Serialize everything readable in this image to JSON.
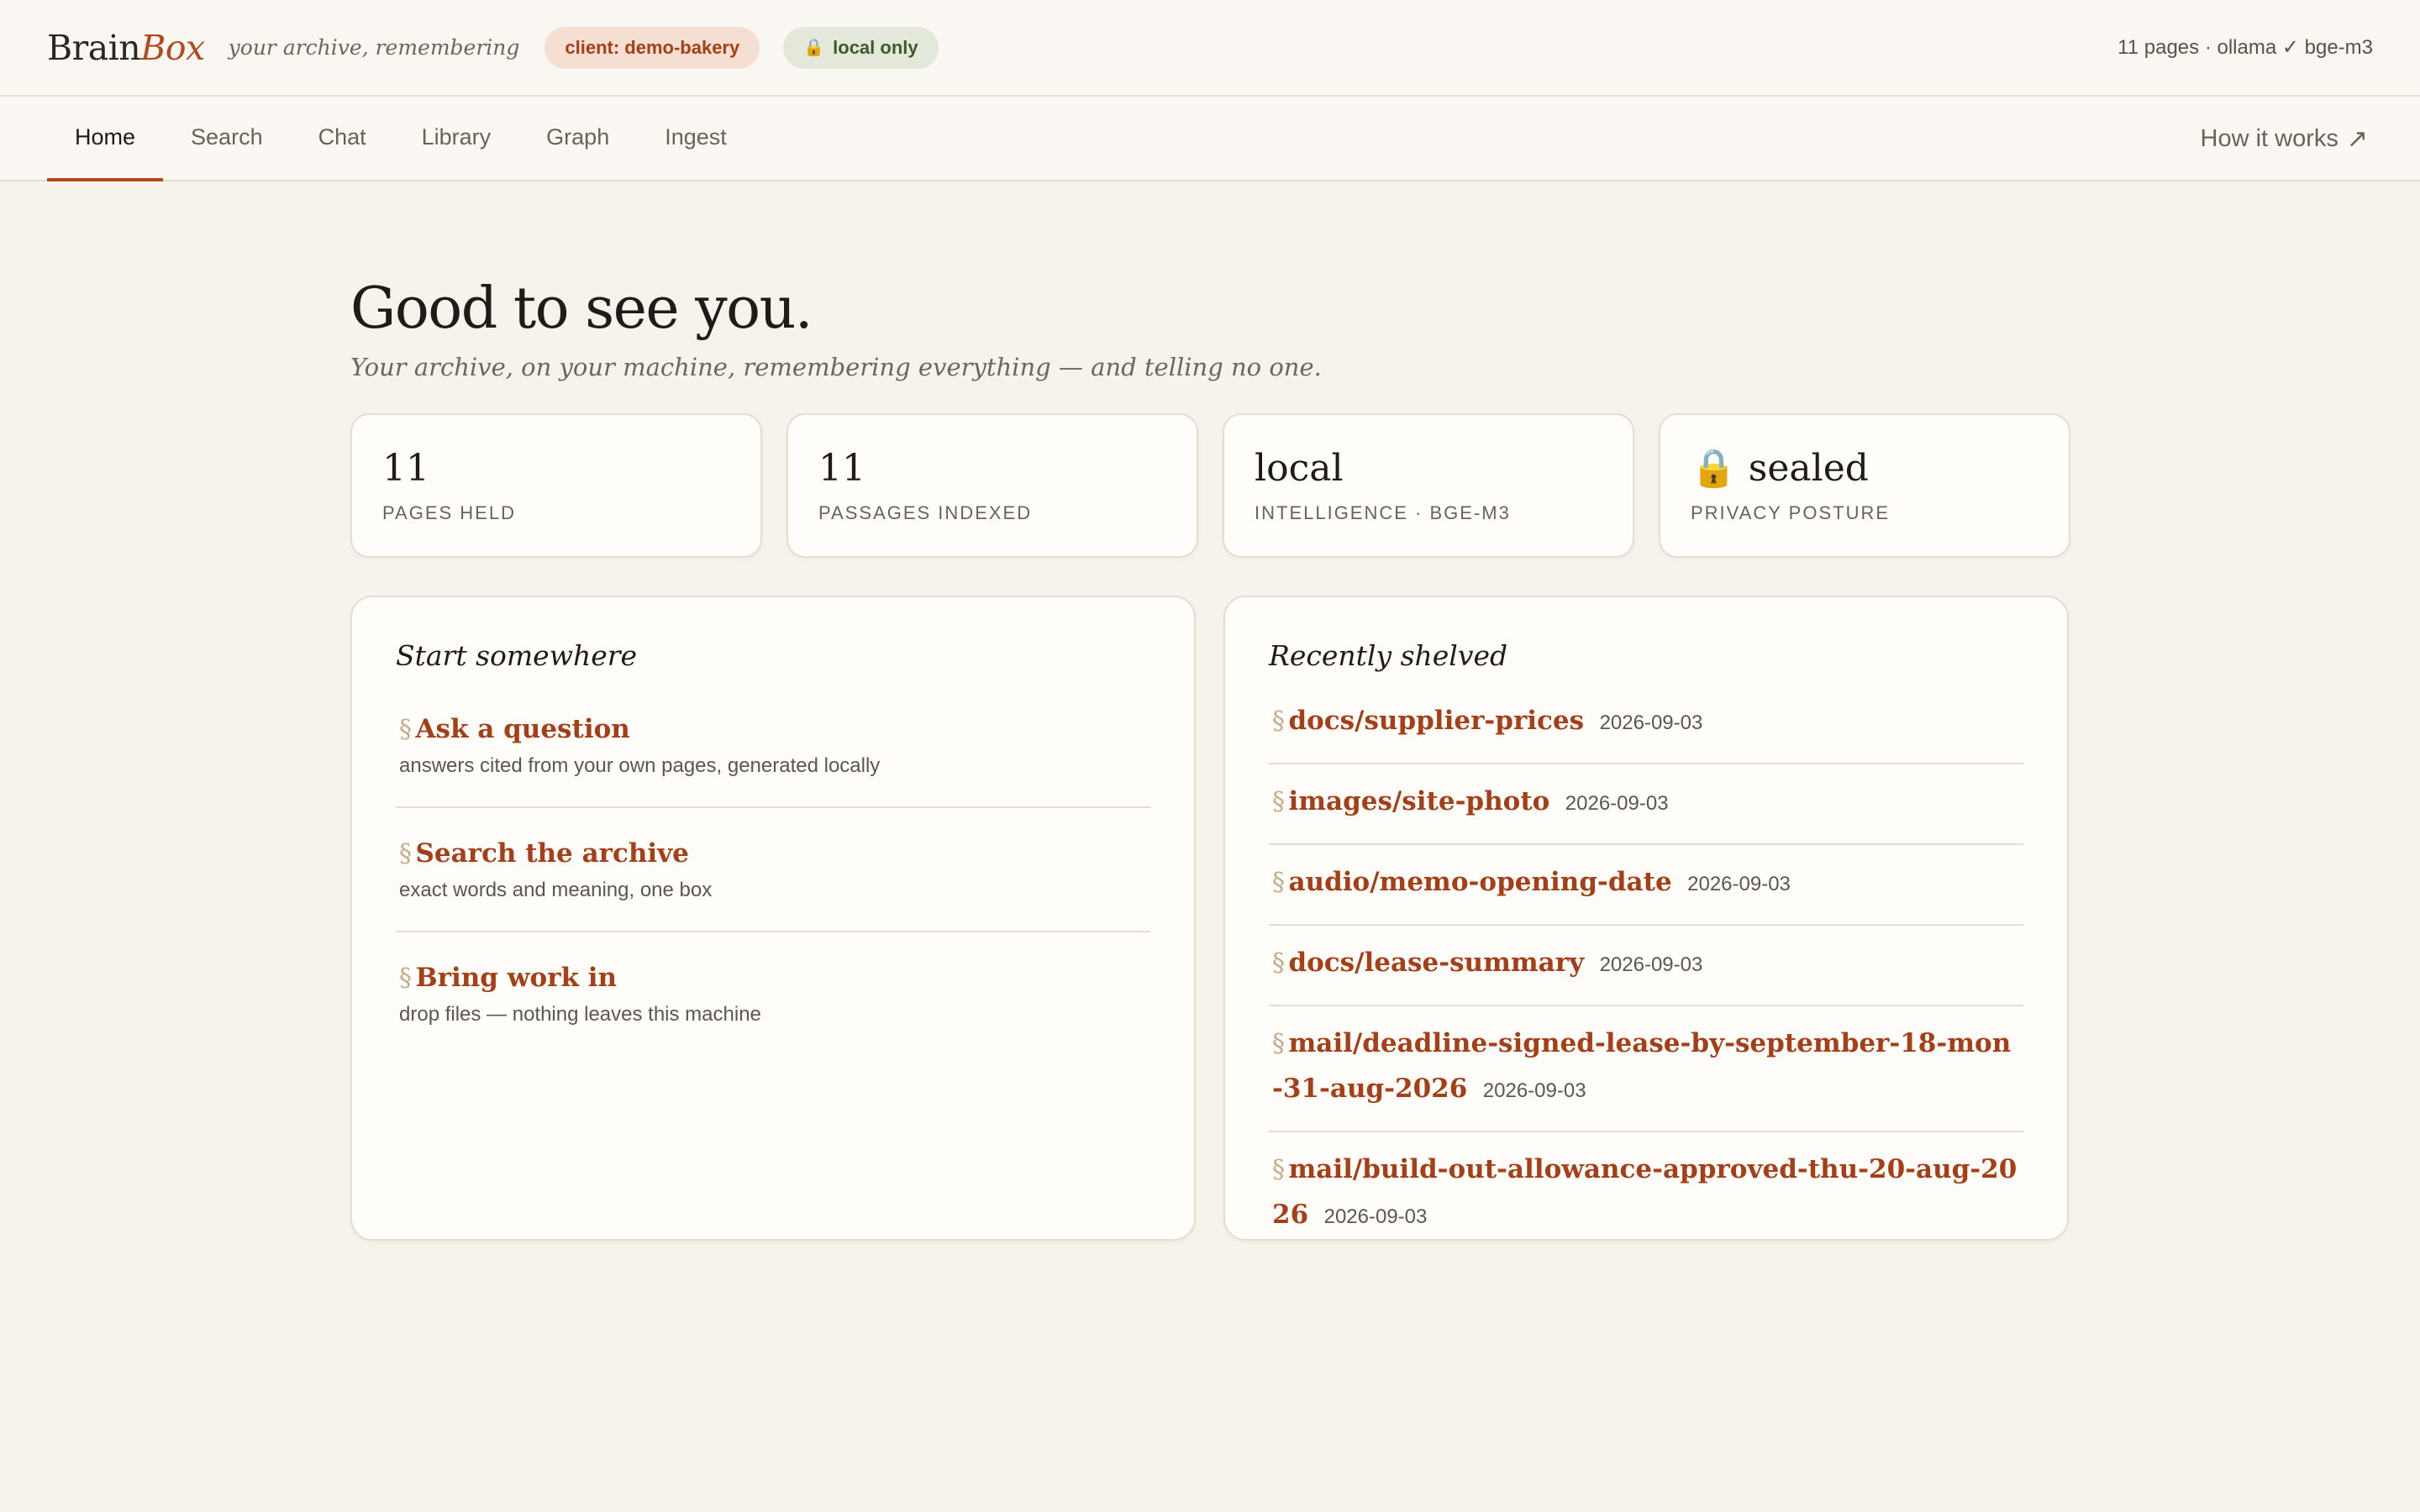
{
  "app": {
    "brand_main": "Brain",
    "brand_accent": "Box",
    "tagline": "your archive, remembering",
    "client_pill": "client: demo-bakery",
    "local_pill": "local only",
    "status": "11 pages · ollama ✓ bge-m3"
  },
  "nav": {
    "tabs": [
      "Home",
      "Search",
      "Chat",
      "Library",
      "Graph",
      "Ingest"
    ],
    "active": "Home",
    "how_it_works": "How it works",
    "how_arrow": "↗"
  },
  "hero": {
    "title": "Good to see you.",
    "subtitle": "Your archive, on your machine, remembering everything — and telling no one."
  },
  "stats": [
    {
      "value": "11",
      "label": "Pages held"
    },
    {
      "value": "11",
      "label": "Passages indexed"
    },
    {
      "value": "local",
      "label": "Intelligence · bge-m3"
    },
    {
      "value": "sealed",
      "label": "Privacy posture",
      "icon": "lock-icon"
    }
  ],
  "start": {
    "heading": "Start somewhere",
    "section_mark": "§",
    "items": [
      {
        "title": "Ask a question",
        "desc": "answers cited from your own pages, generated locally"
      },
      {
        "title": "Search the archive",
        "desc": "exact words and meaning, one box"
      },
      {
        "title": "Bring work in",
        "desc": "drop files — nothing leaves this machine"
      }
    ]
  },
  "recent": {
    "heading": "Recently shelved",
    "items": [
      {
        "path": "docs/supplier-prices",
        "date": "2026-09-03"
      },
      {
        "path": "images/site-photo",
        "date": "2026-09-03"
      },
      {
        "path": "audio/memo-opening-date",
        "date": "2026-09-03"
      },
      {
        "path": "docs/lease-summary",
        "date": "2026-09-03"
      },
      {
        "path": "mail/deadline-signed-lease-by-september-18-mon-31-aug-2026",
        "date": "2026-09-03"
      },
      {
        "path": "mail/build-out-allowance-approved-thu-20-aug-2026",
        "date": "2026-09-03"
      }
    ]
  },
  "colors": {
    "accent": "#b24a1f",
    "background": "#f6f2ec",
    "card": "#fffdfa"
  }
}
